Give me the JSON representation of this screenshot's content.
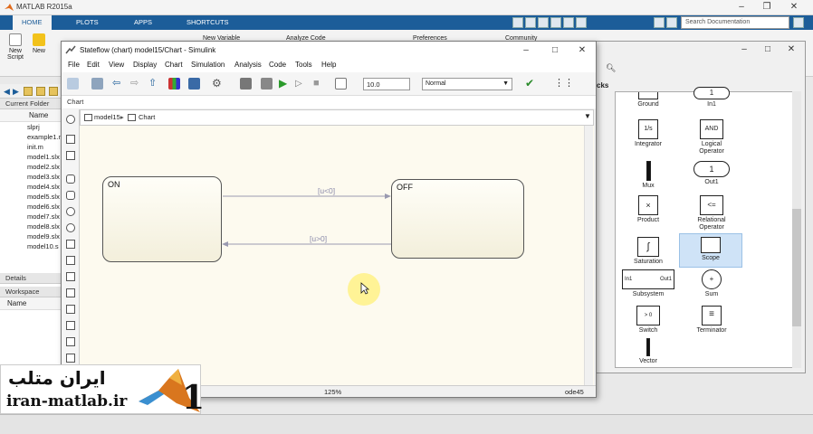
{
  "matlab": {
    "title": "MATLAB R2015a",
    "tabs": [
      "HOME",
      "PLOTS",
      "APPS",
      "SHORTCUTS"
    ],
    "search_placeholder": "Search Documentation",
    "ribbon": {
      "new_script": "New\nScript",
      "new": "New",
      "new_variable": "New Variable",
      "analyze_code": "Analyze Code",
      "preferences": "Preferences",
      "community": "Community"
    },
    "current_folder": "Current Folder",
    "name_col": "Name",
    "files": [
      "slprj",
      "example1.m",
      "init.m",
      "model1.slx",
      "model2.slx",
      "model3.slx",
      "model4.slx",
      "model5.slx",
      "model6.slx",
      "model7.slx",
      "model8.slx",
      "model9.slx",
      "model10.s"
    ],
    "details": "Details",
    "workspace": "Workspace",
    "workspace_name_col": "Name"
  },
  "stateflow": {
    "title": "Stateflow (chart) model15/Chart - Simulink",
    "menu": [
      "File",
      "Edit",
      "View",
      "Display",
      "Chart",
      "Simulation",
      "Analysis",
      "Code",
      "Tools",
      "Help"
    ],
    "stop_time": "10.0",
    "sim_mode": "Normal",
    "tab": "Chart",
    "breadcrumb": [
      "model15",
      "Chart"
    ],
    "states": [
      {
        "name": "ON"
      },
      {
        "name": "OFF"
      }
    ],
    "transitions": [
      {
        "label": "[u<0]",
        "from": "ON",
        "to": "OFF"
      },
      {
        "label": "[u>0]",
        "from": "OFF",
        "to": "ON"
      }
    ],
    "zoom": "125%",
    "solver": "ode45"
  },
  "library": {
    "partial_label": "cks",
    "blocks": [
      {
        "label": "Ground"
      },
      {
        "label": "In1",
        "glyph": "1"
      },
      {
        "label": "Integrator",
        "glyph": "1/s"
      },
      {
        "label": "Logical\nOperator",
        "glyph": "AND"
      },
      {
        "label": "Mux"
      },
      {
        "label": "Out1",
        "glyph": "1"
      },
      {
        "label": "Product",
        "glyph": "×"
      },
      {
        "label": "Relational\nOperator",
        "glyph": "<="
      },
      {
        "label": "Saturation"
      },
      {
        "label": "Scope"
      },
      {
        "label": "Subsystem",
        "in": "In1",
        "out": "Out1"
      },
      {
        "label": "Sum",
        "glyph": "+"
      },
      {
        "label": "Switch",
        "glyph": "> 0"
      },
      {
        "label": "Terminator"
      },
      {
        "label": "Vector"
      }
    ]
  },
  "watermark": {
    "title": "ایران متلب",
    "url": "iran-matlab.ir"
  }
}
